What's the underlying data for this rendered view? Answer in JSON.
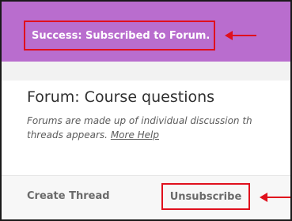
{
  "banner": {
    "message": "Success: Subscribed to Forum."
  },
  "forum": {
    "title": "Forum: Course questions",
    "description_line1": "Forums are made up of individual discussion th",
    "description_line2_prefix": "threads appears.",
    "more_help": "More Help"
  },
  "actions": {
    "create_thread": "Create Thread",
    "unsubscribe": "Unsubscribe"
  },
  "colors": {
    "banner_bg": "#b96dce",
    "highlight_red": "#e0101d"
  },
  "icons": {
    "annotation_arrow": "arrow-left-icon"
  }
}
